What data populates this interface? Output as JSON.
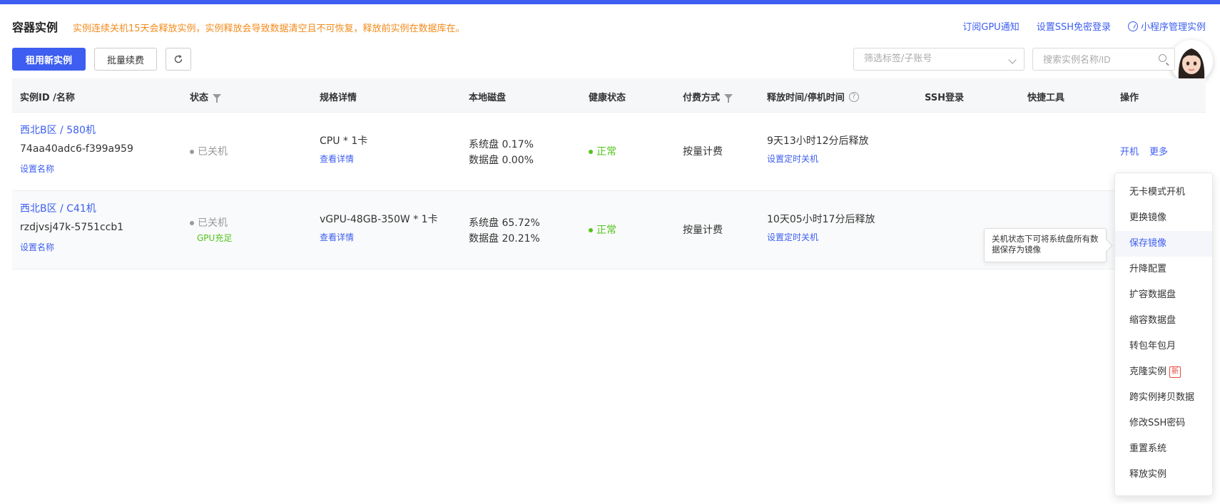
{
  "header": {
    "title": "容器实例",
    "warning": "实例连续关机15天会释放实例，实例释放会导致数据清空且不可恢复，释放前实例在数据库在。",
    "links": {
      "gpu_notice": "订阅GPU通知",
      "ssh_login": "设置SSH免密登录",
      "mini_program": "小程序管理实例"
    }
  },
  "toolbar": {
    "rent_label": "租用新实例",
    "batch_renew_label": "批量续费",
    "filter_placeholder": "筛选标签/子账号",
    "search_placeholder": "搜索实例名称/ID"
  },
  "table": {
    "columns": {
      "id": "实例ID /名称",
      "status": "状态",
      "spec": "规格详情",
      "disk": "本地磁盘",
      "health": "健康状态",
      "payment": "付费方式",
      "release": "释放时间/停机时间",
      "ssh": "SSH登录",
      "tools": "快捷工具",
      "actions": "操作"
    },
    "rows": [
      {
        "name": "西北B区 / 580机",
        "id": "74aa40adc6-f399a959",
        "set_name": "设置名称",
        "status": "已关机",
        "gpu_status": "",
        "spec": "CPU * 1卡",
        "view_detail": "查看详情",
        "sys_disk": "系统盘 0.17%",
        "data_disk": "数据盘 0.00%",
        "health": "正常",
        "payment": "按量计费",
        "release": "9天13小时12分后释放",
        "set_shutdown": "设置定时关机",
        "power_on": "开机",
        "more": "更多"
      },
      {
        "name": "西北B区 / C41机",
        "id": "rzdjvsj47k-5751ccb1",
        "set_name": "设置名称",
        "status": "已关机",
        "gpu_status": "GPU充足",
        "spec": "vGPU-48GB-350W * 1卡",
        "view_detail": "查看详情",
        "sys_disk": "系统盘 65.72%",
        "data_disk": "数据盘 20.21%",
        "health": "正常",
        "payment": "按量计费",
        "release": "10天05小时17分后释放",
        "set_shutdown": "设置定时关机"
      }
    ]
  },
  "more_menu": {
    "items": [
      "无卡模式开机",
      "更换镜像",
      "保存镜像",
      "升降配置",
      "扩容数据盘",
      "缩容数据盘",
      "转包年包月",
      "克隆实例",
      "跨实例拷贝数据",
      "修改SSH密码",
      "重置系统",
      "释放实例"
    ],
    "new_badge": "新",
    "active_index": 2
  },
  "tooltip": {
    "text": "关机状态下可将系统盘所有数据保存为镜像"
  },
  "colors": {
    "primary": "#3d5ef0",
    "warning": "#f28b1c",
    "success": "#52c41a"
  }
}
